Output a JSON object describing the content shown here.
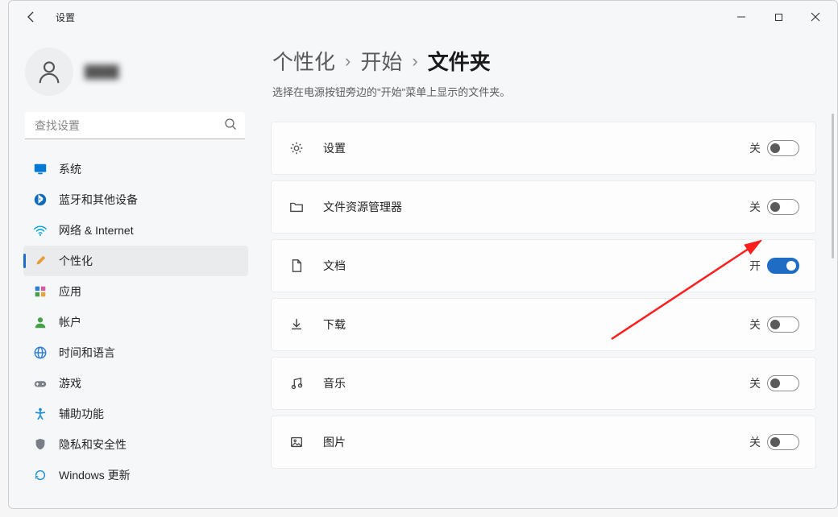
{
  "window": {
    "title": "设置"
  },
  "user": {
    "name": "████"
  },
  "search": {
    "placeholder": "查找设置"
  },
  "sidebar": {
    "items": [
      {
        "id": "system",
        "label": "系统",
        "icon": "monitor",
        "color": "#0078d4"
      },
      {
        "id": "bluetooth",
        "label": "蓝牙和其他设备",
        "icon": "bluetooth",
        "color": "#0f6cbd"
      },
      {
        "id": "network",
        "label": "网络 & Internet",
        "icon": "wifi",
        "color": "#00a3da"
      },
      {
        "id": "personalize",
        "label": "个性化",
        "icon": "brush",
        "color": "#e89c3c",
        "active": true
      },
      {
        "id": "apps",
        "label": "应用",
        "icon": "apps",
        "color": "#2e7dd7"
      },
      {
        "id": "accounts",
        "label": "帐户",
        "icon": "user",
        "color": "#46a049"
      },
      {
        "id": "time",
        "label": "时间和语言",
        "icon": "globe",
        "color": "#2e7dd7"
      },
      {
        "id": "gaming",
        "label": "游戏",
        "icon": "gamepad",
        "color": "#7a7f87"
      },
      {
        "id": "accessibility",
        "label": "辅助功能",
        "icon": "access",
        "color": "#1a8fd8"
      },
      {
        "id": "privacy",
        "label": "隐私和安全性",
        "icon": "shield",
        "color": "#7a7f87"
      },
      {
        "id": "update",
        "label": "Windows 更新",
        "icon": "refresh",
        "color": "#1a8fd8"
      }
    ]
  },
  "breadcrumb": {
    "crumb1": "个性化",
    "crumb2": "开始",
    "current": "文件夹",
    "sep": "›"
  },
  "description": "选择在电源按钮旁边的\"开始\"菜单上显示的文件夹。",
  "state_labels": {
    "on": "开",
    "off": "关"
  },
  "folders": [
    {
      "id": "settings",
      "label": "设置",
      "icon": "gear",
      "on": false
    },
    {
      "id": "explorer",
      "label": "文件资源管理器",
      "icon": "folder",
      "on": false
    },
    {
      "id": "documents",
      "label": "文档",
      "icon": "document",
      "on": true
    },
    {
      "id": "downloads",
      "label": "下载",
      "icon": "download",
      "on": false
    },
    {
      "id": "music",
      "label": "音乐",
      "icon": "music",
      "on": false
    },
    {
      "id": "pictures",
      "label": "图片",
      "icon": "image",
      "on": false
    }
  ]
}
